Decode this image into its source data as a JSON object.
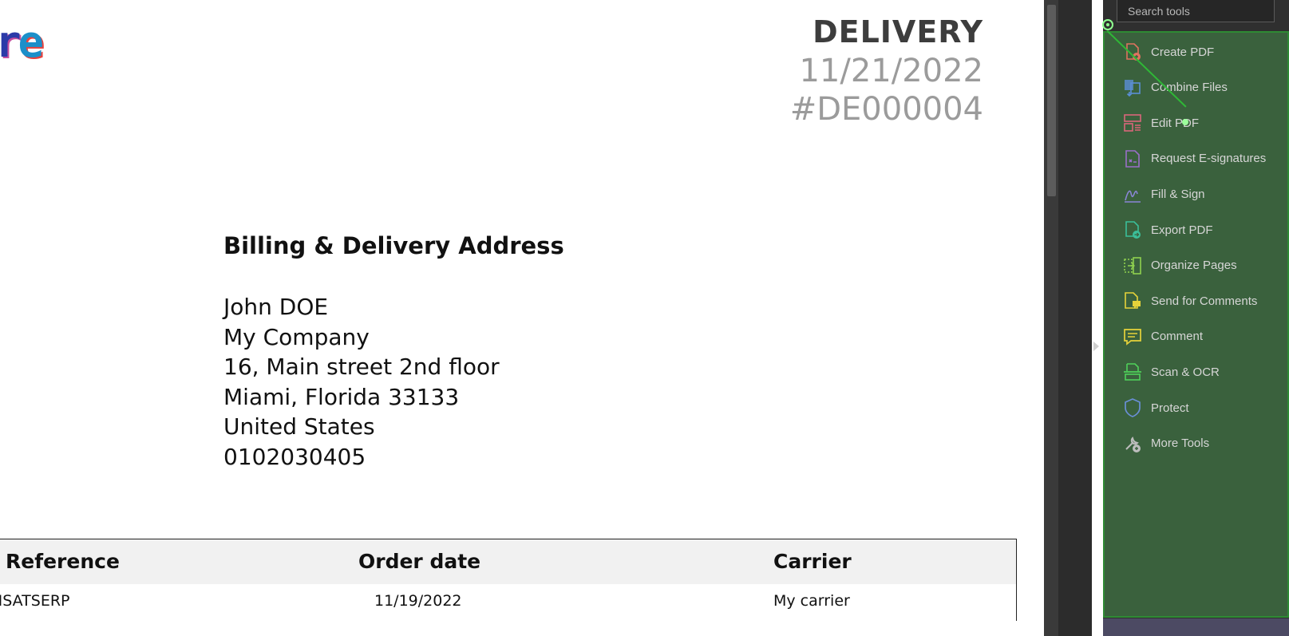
{
  "document": {
    "logo_text_a": "r",
    "logo_text_b": "e",
    "title": "DELIVERY",
    "date": "11/21/2022",
    "number": "#DE000004",
    "address_heading": "Billing & Delivery Address",
    "address_lines": [
      "John DOE",
      "My Company",
      "16, Main street 2nd floor",
      "Miami, Florida 33133",
      "United States",
      "0102030405"
    ],
    "table": {
      "headers": [
        "Reference",
        "Order date",
        "Carrier"
      ],
      "row": [
        "NSATSERP",
        "11/19/2022",
        "My carrier"
      ]
    }
  },
  "tools_panel": {
    "search_placeholder": "Search tools",
    "tools": [
      {
        "label": "Create PDF",
        "icon": "create-pdf-icon",
        "color": "#e0735f"
      },
      {
        "label": "Combine Files",
        "icon": "combine-files-icon",
        "color": "#5b8fd6"
      },
      {
        "label": "Edit PDF",
        "icon": "edit-pdf-icon",
        "color": "#d9667a"
      },
      {
        "label": "Request E-signatures",
        "icon": "e-signature-icon",
        "color": "#9a6fc9"
      },
      {
        "label": "Fill & Sign",
        "icon": "fill-sign-icon",
        "color": "#8a86d6"
      },
      {
        "label": "Export PDF",
        "icon": "export-pdf-icon",
        "color": "#3bbf9a"
      },
      {
        "label": "Organize Pages",
        "icon": "organize-pages-icon",
        "color": "#8fd14f"
      },
      {
        "label": "Send for Comments",
        "icon": "send-comments-icon",
        "color": "#e6d23a"
      },
      {
        "label": "Comment",
        "icon": "comment-icon",
        "color": "#e6d23a"
      },
      {
        "label": "Scan & OCR",
        "icon": "scan-ocr-icon",
        "color": "#4fd15a"
      },
      {
        "label": "Protect",
        "icon": "shield-icon",
        "color": "#6a8fd6"
      },
      {
        "label": "More Tools",
        "icon": "more-tools-icon",
        "color": "#bdbdbd"
      }
    ]
  }
}
